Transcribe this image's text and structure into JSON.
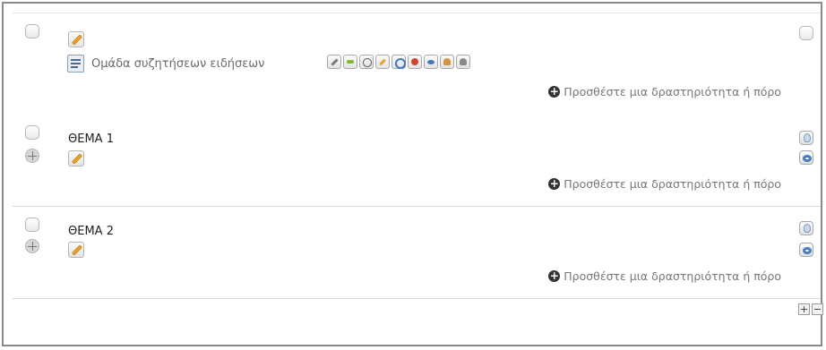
{
  "top_section": {
    "forum_name": "Ομάδα συζητήσεων ειδήσεων",
    "add_activity": "Προσθέστε μια δραστηριότητα ή πόρο",
    "tool_icons": [
      "edit-settings-icon",
      "indent-right-icon",
      "move-icon",
      "edit-icon",
      "duplicate-icon",
      "delete-icon",
      "hide-icon",
      "assign-roles-icon",
      "group-mode-icon"
    ]
  },
  "sections": [
    {
      "title": "ΘΕΜΑ 1",
      "add_activity": "Προσθέστε μια δραστηριότητα ή πόρο"
    },
    {
      "title": "ΘΕΜΑ 2",
      "add_activity": "Προσθέστε μια δραστηριότητα ή πόρο"
    }
  ],
  "footer": {
    "add_section_symbol": "+",
    "remove_section_symbol": "−"
  }
}
